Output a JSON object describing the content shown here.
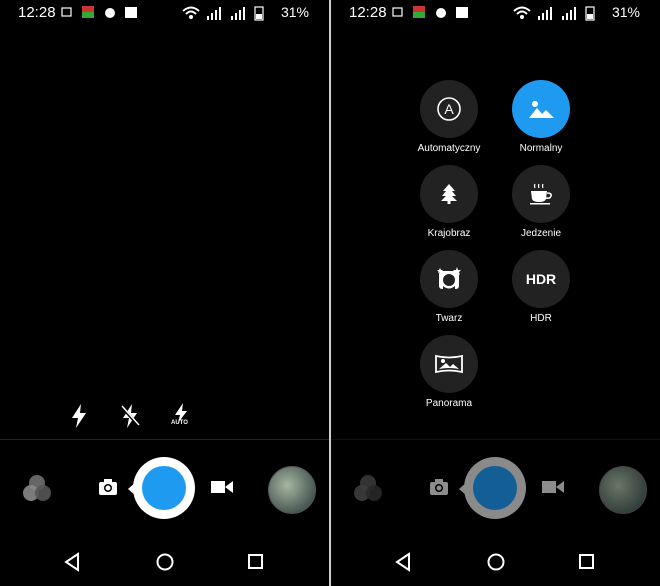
{
  "status_bar": {
    "time": "12:28",
    "battery_percent": "31%"
  },
  "flash_options": [
    "flash-on",
    "flash-off",
    "flash-auto"
  ],
  "flash_auto_label": "AUTO",
  "scene_modes": [
    {
      "label": "Automatyczny",
      "icon": "auto-a-icon",
      "selected": false
    },
    {
      "label": "Normalny",
      "icon": "landscape-photo-icon",
      "selected": true
    },
    {
      "label": "Krajobraz",
      "icon": "tree-icon",
      "selected": false
    },
    {
      "label": "Jedzenie",
      "icon": "coffee-cup-icon",
      "selected": false
    },
    {
      "label": "Twarz",
      "icon": "face-icon",
      "selected": false
    },
    {
      "label": "HDR",
      "icon": "hdr-icon",
      "selected": false
    },
    {
      "label": "Panorama",
      "icon": "panorama-icon",
      "selected": false
    }
  ],
  "hdr_icon_text": "HDR",
  "colors": {
    "accent": "#1e9af0",
    "background": "#000000",
    "mode_circle": "#222222"
  }
}
